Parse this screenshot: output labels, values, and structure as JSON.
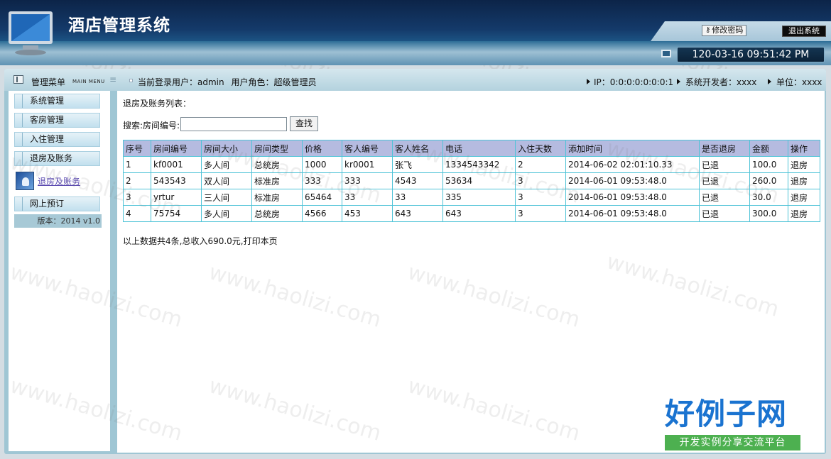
{
  "header": {
    "title": "酒店管理系统",
    "change_password": "修改密码",
    "logout": "退出系统",
    "datetime": "120-03-16 09:51:42 PM"
  },
  "subheader": {
    "menu_title": "管理菜单",
    "menu_title_en": "MAIN MENU",
    "user_label": "当前登录用户：admin",
    "role_label": "用户角色：超级管理员",
    "ip": "IP：0:0:0:0:0:0:0:1",
    "developer": "系统开发者：xxxx",
    "unit": "单位：xxxx"
  },
  "sidebar": {
    "items": [
      {
        "label": "系统管理"
      },
      {
        "label": "客房管理"
      },
      {
        "label": "入住管理"
      },
      {
        "label": "退房及账务"
      },
      {
        "label": "网上预订"
      }
    ],
    "subitem": "退房及账务",
    "version": "版本：2014 v1.0"
  },
  "main": {
    "list_title": "退房及账务列表：",
    "search_label": "搜索:房间编号:",
    "search_value": "",
    "search_button": "查找",
    "columns": [
      "序号",
      "房间编号",
      "房间大小",
      "房间类型",
      "价格",
      "客人编号",
      "客人姓名",
      "电话",
      "入住天数",
      "添加时间",
      "是否退房",
      "金额",
      "操作"
    ],
    "rows": [
      [
        "1",
        "kf0001",
        "多人间",
        "总统房",
        "1000",
        "kr0001",
        "张飞",
        "1334543342",
        "2",
        "2014-06-02 02:01:10.33",
        "已退",
        "100.0",
        "退房"
      ],
      [
        "2",
        "543543",
        "双人间",
        "标准房",
        "333",
        "333",
        "4543",
        "53634",
        "3",
        "2014-06-01 09:53:48.0",
        "已退",
        "260.0",
        "退房"
      ],
      [
        "3",
        "yrtur",
        "三人间",
        "标准房",
        "65464",
        "33",
        "33",
        "335",
        "3",
        "2014-06-01 09:53:48.0",
        "已退",
        "30.0",
        "退房"
      ],
      [
        "4",
        "75754",
        "多人间",
        "总统房",
        "4566",
        "453",
        "643",
        "643",
        "3",
        "2014-06-01 09:53:48.0",
        "已退",
        "300.0",
        "退房"
      ]
    ],
    "summary": "以上数据共4条,总收入690.0元,打印本页"
  },
  "watermark": "www.haolizi.com",
  "badge": {
    "title": "好例子网",
    "subtitle": "开发实例分享交流平台"
  }
}
